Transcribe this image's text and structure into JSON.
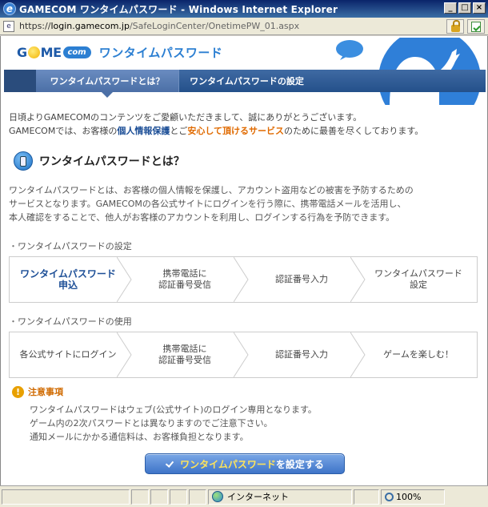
{
  "window": {
    "title": "GAMECOM ワンタイムパスワード - Windows Internet Explorer",
    "buttons": {
      "minimize": "_",
      "maximize": "□",
      "close": "×"
    }
  },
  "address": {
    "prefix": "https://",
    "host": "login.gamecom.jp",
    "path": "/SafeLoginCenter/OnetimePW_01.aspx"
  },
  "header": {
    "logo_text_1": "G",
    "logo_text_2": "ME",
    "logo_com": "com",
    "service_name": "ワンタイムパスワード"
  },
  "nav": {
    "tabs": [
      {
        "label": "ワンタイムパスワードとは？",
        "active": true
      },
      {
        "label": "ワンタイムパスワードの設定",
        "active": false
      }
    ]
  },
  "intro": {
    "line1": "日頃よりGAMECOMのコンテンツをご愛顧いただきまして、誠にありがとうございます。",
    "line2_a": "GAMECOMでは、お客様の",
    "line2_b": "個人情報保護",
    "line2_c": "とご",
    "line2_d": "安心して頂けるサービス",
    "line2_e": "のために最善を尽くしております。"
  },
  "section": {
    "title": "ワンタイムパスワードとは？",
    "desc_line1": "ワンタイムパスワードとは、お客様の個人情報を保護し、アカウント盗用などの被害を予防するための",
    "desc_line2": "サービスとなります。GAMECOMの各公式サイトにログインを行う際に、携帯電話メールを活用し、",
    "desc_line3": "本人確認をすることで、他人がお客様のアカウントを利用し、ログインする行為を予防できます。"
  },
  "flow_setup": {
    "label": "ワンタイムパスワードの設定",
    "steps": [
      {
        "line1": "ワンタイムパスワード",
        "line2": "申込"
      },
      {
        "line1": "携帯電話に",
        "line2": "認証番号受信"
      },
      {
        "line1": "認証番号入力",
        "line2": ""
      },
      {
        "line1": "ワンタイムパスワード",
        "line2": "設定"
      }
    ]
  },
  "flow_use": {
    "label": "ワンタイムパスワードの使用",
    "steps": [
      {
        "line1": "各公式サイトにログイン",
        "line2": ""
      },
      {
        "line1": "携帯電話に",
        "line2": "認証番号受信"
      },
      {
        "line1": "認証番号入力",
        "line2": ""
      },
      {
        "line1": "ゲームを楽しむ！",
        "line2": ""
      }
    ]
  },
  "notice": {
    "title": "注意事項",
    "items": [
      "ワンタイムパスワードはウェブ(公式サイト)のログイン専用となります。",
      "ゲーム内の2次パスワードとは異なりますのでご注意下さい。",
      "通知メールにかかる通信料は、お客様負担となります。"
    ]
  },
  "cta": {
    "label_a": "ワンタイムパスワード",
    "label_b": "を設定する"
  },
  "status": {
    "zone": "インターネット",
    "zoom": "100%"
  },
  "colors": {
    "nav": "#24508a",
    "accent_blue": "#1d4f97",
    "accent_orange": "#e06a00",
    "cta": "#3e74c8"
  }
}
